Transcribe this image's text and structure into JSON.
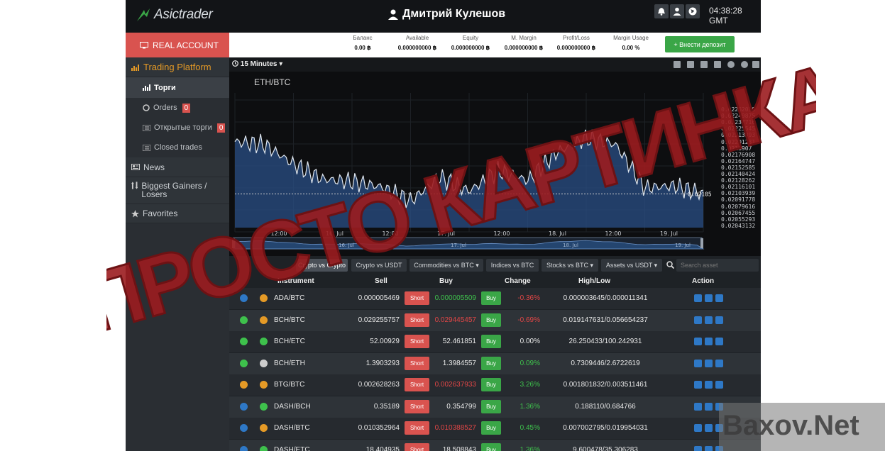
{
  "header": {
    "logo_text": "Asictrader",
    "user_name": "Дмитрий  Кулешов",
    "clock": "04:38:28 GMT"
  },
  "nav": {
    "real_account": "REAL ACCOUNT",
    "trading_platform": "Trading Platform",
    "trades": "Торги",
    "orders": "Orders",
    "orders_count": "0",
    "open_trades": "Открытые торги",
    "open_trades_count": "0",
    "closed_trades": "Closed trades",
    "news": "News",
    "gainers": "Biggest Gainers / Losers",
    "favorites": "Favorites"
  },
  "stats": [
    {
      "label": "Баланс",
      "value": "0.00 ฿"
    },
    {
      "label": "Available",
      "value": "0.000000000 ฿"
    },
    {
      "label": "Equity",
      "value": "0.000000000 ฿"
    },
    {
      "label": "M. Margin",
      "value": "0.000000000 ฿"
    },
    {
      "label": "Profit/Loss",
      "value": "0.000000000 ฿"
    },
    {
      "label": "Margin Usage",
      "value": "0.00 %"
    }
  ],
  "deposit_label": "+ Внести депозит",
  "chart": {
    "timeframe": "15 Minutes",
    "symbol": "ETH/BTC",
    "current_price_label": "0.02105",
    "x_labels": [
      "12:00",
      "16. Jul",
      "12:00",
      "17. Jul",
      "12:00",
      "18. Jul",
      "12:00",
      "19. Jul"
    ],
    "nav_labels": [
      "16. Jul",
      "17. Jul",
      "18. Jul",
      "19. Jul"
    ],
    "price_ticks": [
      "0.02262039",
      "0.02249875",
      "0.02237716",
      "0.02225545",
      "0.02213393",
      "0.02201231",
      "0.0218907",
      "0.02176908",
      "0.02164747",
      "0.02152585",
      "0.02140424",
      "0.02128262",
      "0.02116101",
      "0.02103939",
      "0.02091778",
      "0.02079616",
      "0.02067455",
      "0.02055293",
      "0.02043132"
    ]
  },
  "chart_data": {
    "type": "area",
    "title": "ETH/BTC",
    "xlabel": "",
    "ylabel": "",
    "ylim": [
      0.02043132,
      0.02262039
    ],
    "x": [
      "12:00",
      "16. Jul",
      "12:00",
      "17. Jul",
      "12:00",
      "18. Jul",
      "12:00",
      "19. Jul"
    ],
    "series": [
      {
        "values": [
          0.02201,
          0.02196,
          0.0216,
          0.02132,
          0.02128,
          0.02118,
          0.02092,
          0.02136,
          0.0211,
          0.02148,
          0.0213,
          0.02182,
          0.02208,
          0.02196,
          0.02116,
          0.0212,
          0.02105
        ]
      }
    ],
    "current_value": 0.02105,
    "grid": true
  },
  "filters": [
    "Crypto vs Crypto",
    "Crypto vs USDT",
    "Commodities vs BTC ▾",
    "Indices vs BTC",
    "Stocks vs BTC ▾",
    "Assets vs USDT ▾"
  ],
  "search_placeholder": "Search asset",
  "table": {
    "headers": [
      "Instrument",
      "Sell",
      "Buy",
      "Change",
      "High/Low",
      "Action"
    ],
    "short_label": "Short",
    "buy_label": "Buy",
    "rows": [
      {
        "instrument": "ADA/BTC",
        "sell": "0.000005469",
        "buy": "0.000005509",
        "buy_color": "green",
        "change": "-0.36%",
        "change_dir": "neg",
        "highlow": "0.000003645/0.000011341",
        "c1": "#2e78c6",
        "c2": "#e59a26"
      },
      {
        "instrument": "BCH/BTC",
        "sell": "0.029255757",
        "buy": "0.029445457",
        "buy_color": "red",
        "change": "-0.69%",
        "change_dir": "neg",
        "highlow": "0.019147631/0.056654237",
        "c1": "#3ec14c",
        "c2": "#e59a26"
      },
      {
        "instrument": "BCH/ETC",
        "sell": "52.00929",
        "buy": "52.461851",
        "buy_color": "white",
        "change": "0.00%",
        "change_dir": "neu",
        "highlow": "26.250433/100.242931",
        "c1": "#3ec14c",
        "c2": "#3ec14c"
      },
      {
        "instrument": "BCH/ETH",
        "sell": "1.3903293",
        "buy": "1.3984557",
        "buy_color": "white",
        "change": "0.09%",
        "change_dir": "pos",
        "highlow": "0.7309446/2.6722619",
        "c1": "#3ec14c",
        "c2": "#cccccc"
      },
      {
        "instrument": "BTG/BTC",
        "sell": "0.002628263",
        "buy": "0.002637933",
        "buy_color": "red",
        "change": "3.26%",
        "change_dir": "pos",
        "highlow": "0.001801832/0.003511461",
        "c1": "#e59a26",
        "c2": "#e59a26"
      },
      {
        "instrument": "DASH/BCH",
        "sell": "0.35189",
        "buy": "0.354799",
        "buy_color": "white",
        "change": "1.36%",
        "change_dir": "pos",
        "highlow": "0.188110/0.684766",
        "c1": "#2e78c6",
        "c2": "#3ec14c"
      },
      {
        "instrument": "DASH/BTC",
        "sell": "0.010352964",
        "buy": "0.010388527",
        "buy_color": "red",
        "change": "0.45%",
        "change_dir": "pos",
        "highlow": "0.007002795/0.019954031",
        "c1": "#2e78c6",
        "c2": "#e59a26"
      },
      {
        "instrument": "DASH/ETC",
        "sell": "18.404935",
        "buy": "18.508843",
        "buy_color": "white",
        "change": "1.36%",
        "change_dir": "pos",
        "highlow": "9.600478/35.306283",
        "c1": "#2e78c6",
        "c2": "#3ec14c"
      }
    ]
  },
  "overlay": {
    "stamp_text": "ПРОСТО КАРТИНКА",
    "watermark_text": "Baxov.Net"
  },
  "colors": {
    "sell_button": "#d9534f",
    "buy_button": "#3aa647",
    "accent": "#e59a26",
    "stamp": "#9b1c1f"
  }
}
